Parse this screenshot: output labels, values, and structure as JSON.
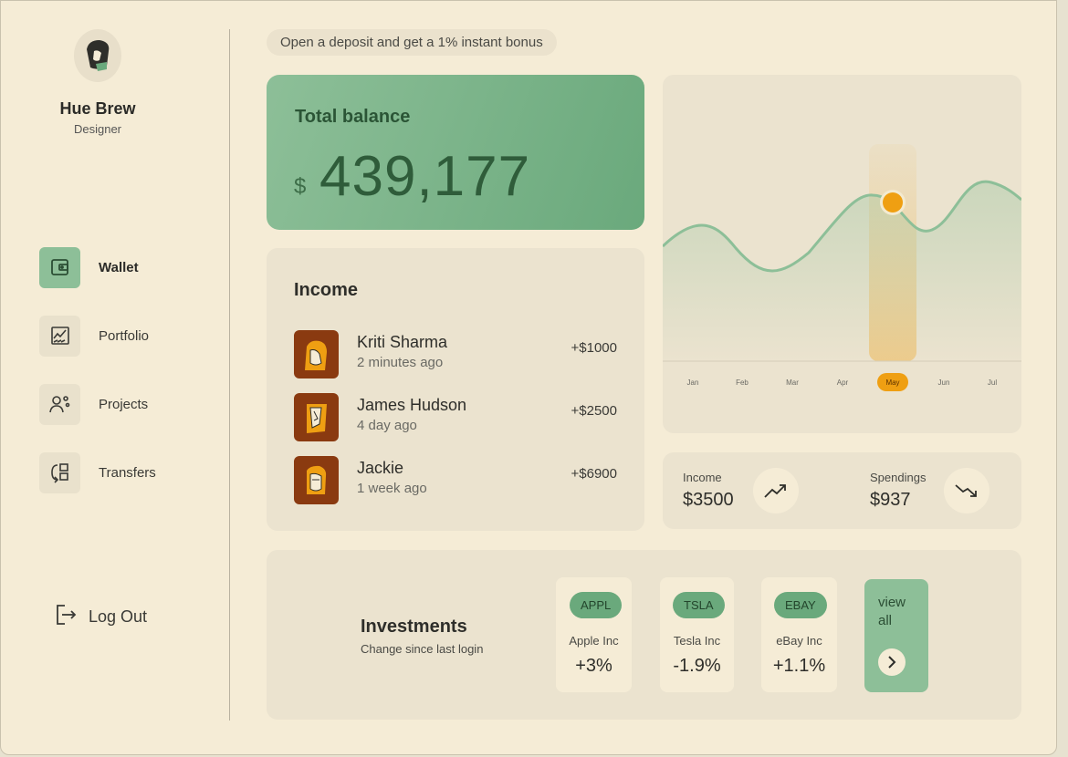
{
  "profile": {
    "name": "Hue Brew",
    "role": "Designer"
  },
  "nav": {
    "items": [
      {
        "label": "Wallet",
        "icon": "wallet-icon",
        "active": true
      },
      {
        "label": "Portfolio",
        "icon": "chart-icon",
        "active": false
      },
      {
        "label": "Projects",
        "icon": "team-icon",
        "active": false
      },
      {
        "label": "Transfers",
        "icon": "transfer-icon",
        "active": false
      }
    ],
    "logout_label": "Log Out"
  },
  "promo": {
    "text": "Open a deposit and get a 1% instant bonus"
  },
  "balance": {
    "title": "Total balance",
    "currency": "$",
    "amount": "439,177"
  },
  "chart": {
    "months": [
      "Jan",
      "Feb",
      "Mar",
      "Apr",
      "May",
      "Jun",
      "Jul"
    ],
    "selected": "May",
    "accent": "#ef9f12",
    "line_color": "#8dbf98"
  },
  "income": {
    "title": "Income",
    "rows": [
      {
        "name": "Kriti Sharma",
        "time": "2 minutes ago",
        "amount": "+$1000"
      },
      {
        "name": "James Hudson",
        "time": "4 day ago",
        "amount": "+$2500"
      },
      {
        "name": "Jackie",
        "time": "1 week ago",
        "amount": "+$6900"
      }
    ]
  },
  "stats": {
    "income_label": "Income",
    "income_value": "$3500",
    "income_icon": "trend-up-icon",
    "spend_label": "Spendings",
    "spend_value": "$937",
    "spend_icon": "trend-down-icon"
  },
  "investments": {
    "title": "Investments",
    "subtitle": "Change since last login",
    "stocks": [
      {
        "ticker": "APPL",
        "name": "Apple Inc",
        "change": "+3%"
      },
      {
        "ticker": "TSLA",
        "name": "Tesla Inc",
        "change": "-1.9%"
      },
      {
        "ticker": "EBAY",
        "name": "eBay Inc",
        "change": "+1.1%"
      }
    ],
    "view_all": "view all"
  },
  "colors": {
    "green": "#8dbf98",
    "dark_green": "#6aa97c",
    "orange": "#ef9f12",
    "background": "#f5ecd6"
  }
}
